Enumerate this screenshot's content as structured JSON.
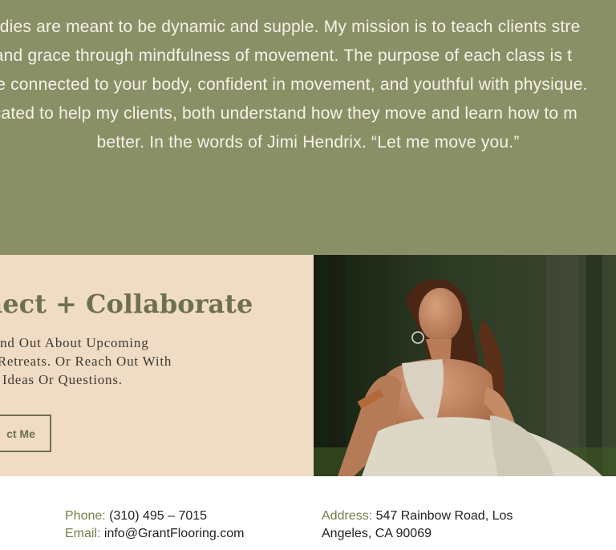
{
  "mission": {
    "lines": [
      "bodies are meant to be dynamic and supple. My mission is to teach clients stre",
      "ty and grace through mindfulness of movement. The purpose of each class is t",
      "re connected to your body, confident in movement, and youthful with physique.",
      "dicated to help my clients, both understand how they move and learn how to m",
      "better. In the words of Jimi Hendrix. “Let me move you.”"
    ]
  },
  "connect": {
    "title": "nect + Collaborate",
    "text_lines": [
      "To Find Out About Upcoming",
      "And Retreats. Or Reach Out With",
      "ation Ideas Or Questions."
    ],
    "button_label": "ct Me"
  },
  "footer": {
    "phone_label": "Phone:",
    "phone_value": "(310) 495 – 7015",
    "email_label": "Email:",
    "email_value": "info@GrantFlooring.com",
    "address_label": "Address:",
    "address_line1": "547 Rainbow Road, Los",
    "address_line2": "Angeles, CA 90069"
  },
  "colors": {
    "mission_bg": "#8a9065",
    "connect_bg": "#f0dcc4",
    "accent": "#6e7050",
    "footer_label": "#7a7d48"
  }
}
